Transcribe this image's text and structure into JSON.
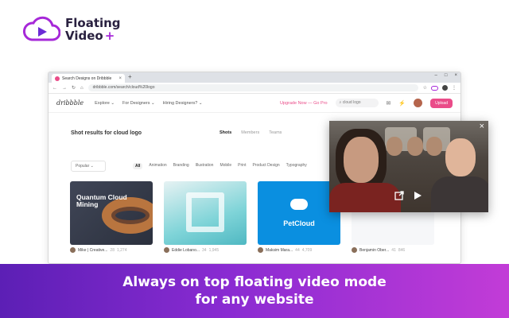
{
  "logo": {
    "line1": "Floating",
    "line2": "Video",
    "plus": "+",
    "icon": "cloud-play-icon",
    "brand_color": "#a628d8"
  },
  "browser": {
    "tab_title": "Search Designs on Dribbble",
    "tab_close": "×",
    "new_tab": "+",
    "window_controls": [
      "–",
      "□",
      "×"
    ],
    "url": "dribbble.com/search/cloud%20logo"
  },
  "dribbble_nav": {
    "logo": "dribbble",
    "links": [
      "Explore ⌄",
      "For Designers ⌄",
      "Hiring Designers? ⌄"
    ],
    "upgrade": "Upgrade Now — Go Pro",
    "search_value": "cloud logo",
    "upload": "Upload",
    "accent": "#ea4c89"
  },
  "results": {
    "title": "Shot results for cloud logo",
    "tabs": [
      "Shots",
      "Members",
      "Teams"
    ],
    "sort": "Popular",
    "filters": [
      "All",
      "Animation",
      "Branding",
      "Illustration",
      "Mobile",
      "Print",
      "Product Design",
      "Typography"
    ]
  },
  "cards": [
    {
      "title": "Quantum Cloud Mining",
      "author": "Mike | Creative...",
      "likes": "28",
      "views": "1,274"
    },
    {
      "title": "",
      "author": "Eddie Lobano...",
      "likes": "34",
      "views": "1,945"
    },
    {
      "title": "PetCloud",
      "author": "Maksim Mara...",
      "likes": "44",
      "views": "4,709"
    },
    {
      "title": "",
      "author": "Benjamin Ober...",
      "likes": "41",
      "views": "846"
    }
  ],
  "video": {
    "close": "×",
    "popout_icon": "popout-icon",
    "play_icon": "play-icon"
  },
  "banner": {
    "line1": "Always on top floating video mode",
    "line2": "for any website"
  }
}
